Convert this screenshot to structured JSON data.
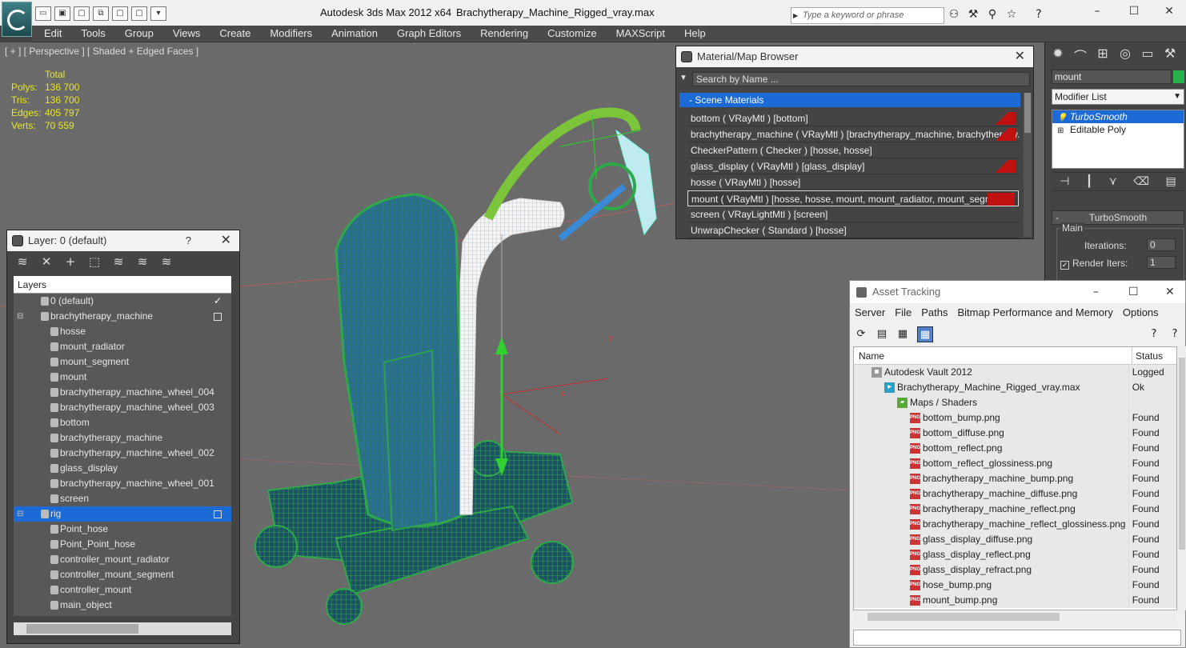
{
  "window": {
    "app_title": "Autodesk 3ds Max  2012 x64",
    "file_title": "Brachytherapy_Machine_Rigged_vray.max",
    "search_placeholder": "Type a keyword or phrase"
  },
  "menu": [
    "Edit",
    "Tools",
    "Group",
    "Views",
    "Create",
    "Modifiers",
    "Animation",
    "Graph Editors",
    "Rendering",
    "Customize",
    "MAXScript",
    "Help"
  ],
  "viewport": {
    "label": "[ + ] [ Perspective ] [ Shaded + Edged Faces ]",
    "stats": {
      "header": "Total",
      "rows": [
        {
          "k": "Polys:",
          "v": "136 700"
        },
        {
          "k": "Tris:",
          "v": "136 700"
        },
        {
          "k": "Edges:",
          "v": "405 797"
        },
        {
          "k": "Verts:",
          "v": "70 559"
        }
      ]
    },
    "gizmo": {
      "x": "x",
      "y": "y",
      "z": "z"
    }
  },
  "layer_panel": {
    "title": "Layer: 0 (default)",
    "help": "?",
    "header": "Layers",
    "rows": [
      {
        "label": "0 (default)",
        "level": 0
      },
      {
        "label": "brachytherapy_machine",
        "level": 0
      },
      {
        "label": "hosse",
        "level": 1
      },
      {
        "label": "mount_radiator",
        "level": 1
      },
      {
        "label": "mount_segment",
        "level": 1
      },
      {
        "label": "mount",
        "level": 1
      },
      {
        "label": "brachytherapy_machine_wheel_004",
        "level": 1
      },
      {
        "label": "brachytherapy_machine_wheel_003",
        "level": 1
      },
      {
        "label": "bottom",
        "level": 1
      },
      {
        "label": "brachytherapy_machine",
        "level": 1
      },
      {
        "label": "brachytherapy_machine_wheel_002",
        "level": 1
      },
      {
        "label": "glass_display",
        "level": 1
      },
      {
        "label": "brachytherapy_machine_wheel_001",
        "level": 1
      },
      {
        "label": "screen",
        "level": 1
      },
      {
        "label": "rig",
        "level": 0
      },
      {
        "label": "Point_hose",
        "level": 1
      },
      {
        "label": "Point_Point_hose",
        "level": 1
      },
      {
        "label": "controller_mount_radiator",
        "level": 1
      },
      {
        "label": "controller_mount_segment",
        "level": 1
      },
      {
        "label": "controller_mount",
        "level": 1
      },
      {
        "label": "main_object",
        "level": 1
      }
    ]
  },
  "material_browser": {
    "title": "Material/Map Browser",
    "search_placeholder": "Search by Name ...",
    "section": "- Scene Materials",
    "rows": [
      "bottom  ( VRayMtl )  [bottom]",
      "brachytherapy_machine  ( VRayMtl )  [brachytherapy_machine, brachytherapy...",
      "CheckerPattern  ( Checker )  [hosse, hosse]",
      "glass_display  ( VRayMtl ) [glass_display]",
      "hosse  ( VRayMtl )  [hosse]",
      "mount  ( VRayMtl )  [hosse, hosse, mount, mount_radiator, mount_segment]",
      "screen  ( VRayLightMtl )  [screen]",
      "UnwrapChecker  ( Standard )  [hosse]"
    ]
  },
  "command_panel": {
    "object_name": "mount",
    "modifier_list": "Modifier List",
    "stack": [
      "TurboSmooth",
      "Editable Poly"
    ],
    "rollout": "TurboSmooth",
    "group_main": "Main",
    "iterations_label": "Iterations:",
    "iterations_value": "0",
    "render_iters_label": "Render Iters:",
    "render_iters_value": "1"
  },
  "asset_tracking": {
    "title": "Asset Tracking",
    "menu": [
      "Server",
      "File",
      "Paths",
      "Bitmap Performance and Memory",
      "Options"
    ],
    "col_name": "Name",
    "col_status": "Status",
    "rows": [
      {
        "name": "Autodesk Vault 2012",
        "status": "Logged",
        "indent": 22,
        "icon": "vault"
      },
      {
        "name": "Brachytherapy_Machine_Rigged_vray.max",
        "status": "Ok",
        "indent": 38,
        "icon": "max"
      },
      {
        "name": "Maps / Shaders",
        "status": "",
        "indent": 54,
        "icon": "fold"
      },
      {
        "name": "bottom_bump.png",
        "status": "Found",
        "indent": 70,
        "icon": "png"
      },
      {
        "name": "bottom_diffuse.png",
        "status": "Found",
        "indent": 70,
        "icon": "png"
      },
      {
        "name": "bottom_reflect.png",
        "status": "Found",
        "indent": 70,
        "icon": "png"
      },
      {
        "name": "bottom_reflect_glossiness.png",
        "status": "Found",
        "indent": 70,
        "icon": "png"
      },
      {
        "name": "brachytherapy_machine_bump.png",
        "status": "Found",
        "indent": 70,
        "icon": "png"
      },
      {
        "name": "brachytherapy_machine_diffuse.png",
        "status": "Found",
        "indent": 70,
        "icon": "png"
      },
      {
        "name": "brachytherapy_machine_reflect.png",
        "status": "Found",
        "indent": 70,
        "icon": "png"
      },
      {
        "name": "brachytherapy_machine_reflect_glossiness.png",
        "status": "Found",
        "indent": 70,
        "icon": "png"
      },
      {
        "name": "glass_display_diffuse.png",
        "status": "Found",
        "indent": 70,
        "icon": "png"
      },
      {
        "name": "glass_display_reflect.png",
        "status": "Found",
        "indent": 70,
        "icon": "png"
      },
      {
        "name": "glass_display_refract.png",
        "status": "Found",
        "indent": 70,
        "icon": "png"
      },
      {
        "name": "hose_bump.png",
        "status": "Found",
        "indent": 70,
        "icon": "png"
      },
      {
        "name": "mount_bump.png",
        "status": "Found",
        "indent": 70,
        "icon": "png"
      }
    ]
  }
}
